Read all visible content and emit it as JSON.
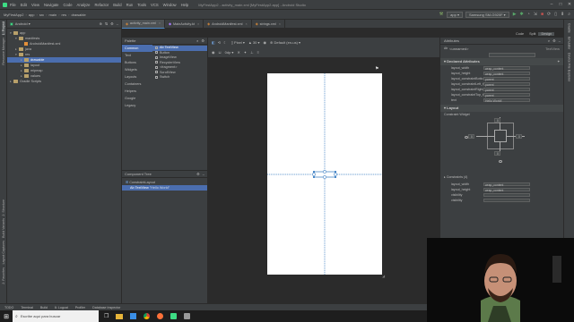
{
  "window": {
    "path_title": "MyFirstApp2 - activity_main.xml [MyFirstApp2.app] - Android Studio",
    "menu": [
      "File",
      "Edit",
      "View",
      "Navigate",
      "Code",
      "Analyze",
      "Refactor",
      "Build",
      "Run",
      "Tools",
      "VCS",
      "Window",
      "Help"
    ]
  },
  "navbar": {
    "crumbs": [
      "MyFirstApp2",
      "app",
      "src",
      "main",
      "res",
      "drawable"
    ],
    "run_config": "app",
    "device": "Samsung SM-G920F"
  },
  "left_tool_tabs": [
    "1: Project",
    "Resource Manager",
    "2: Structure",
    "Build Variants",
    "Layout Captures",
    "2: Favorites"
  ],
  "project": {
    "view_mode": "Android",
    "tree": [
      {
        "label": "app",
        "depth": 0,
        "open": true
      },
      {
        "label": "manifests",
        "depth": 1,
        "open": true
      },
      {
        "label": "AndroidManifest.xml",
        "depth": 2,
        "file": true
      },
      {
        "label": "java",
        "depth": 1,
        "open": false
      },
      {
        "label": "res",
        "depth": 1,
        "open": true
      },
      {
        "label": "drawable",
        "depth": 2,
        "open": false,
        "selected": true
      },
      {
        "label": "layout",
        "depth": 2,
        "open": false
      },
      {
        "label": "mipmap",
        "depth": 2,
        "open": false
      },
      {
        "label": "values",
        "depth": 2,
        "open": false
      },
      {
        "label": "Gradle Scripts",
        "depth": 0,
        "open": false
      }
    ]
  },
  "editor_tabs": [
    {
      "label": "activity_main.xml",
      "active": true
    },
    {
      "label": "MainActivity.kt",
      "active": false
    },
    {
      "label": "AndroidManifest.xml",
      "active": false
    },
    {
      "label": "strings.xml",
      "active": false
    }
  ],
  "view_modes": {
    "code": "Code",
    "split": "Split",
    "design": "Design"
  },
  "palette": {
    "title": "Palette",
    "categories": [
      "Common",
      "Text",
      "Buttons",
      "Widgets",
      "Layouts",
      "Containers",
      "Helpers",
      "Google",
      "Legacy"
    ],
    "items": [
      "Ab TextView",
      "Button",
      "ImageView",
      "RecyclerView",
      "<fragment>",
      "ScrollView",
      "Switch"
    ]
  },
  "component_tree": {
    "title": "Component Tree",
    "root": "ConstraintLayout",
    "child": "Ab TextView",
    "child_text": "\"Hello World\""
  },
  "design_toolbar": {
    "orientation": "Pixel",
    "api": "30",
    "theme": "Default (en-us)",
    "dp": "0dp"
  },
  "attributes": {
    "title": "Attributes",
    "widget_id": "<unnamed>",
    "widget_type": "TextView",
    "declared_title": "Declared Attributes",
    "declared": [
      {
        "k": "layout_width",
        "v": "wrap_content"
      },
      {
        "k": "layout_height",
        "v": "wrap_content"
      },
      {
        "k": "layout_constraintBotto...",
        "v": "parent"
      },
      {
        "k": "layout_constraintLeft_to...",
        "v": "parent"
      },
      {
        "k": "layout_constraintRight_t...",
        "v": "parent"
      },
      {
        "k": "layout_constraintTop_to...",
        "v": "parent"
      },
      {
        "k": "text",
        "v": "Hello World!"
      }
    ],
    "layout_title": "Layout",
    "constraint_widget": "Constraint Widget",
    "margins": [
      "0",
      "0",
      "0",
      "0"
    ],
    "constraints_title": "Constraints (4)",
    "layout_rows": [
      {
        "k": "layout_width",
        "v": "wrap_content"
      },
      {
        "k": "layout_height",
        "v": "wrap_content"
      },
      {
        "k": "visibility",
        "v": ""
      },
      {
        "k": "visibility",
        "v": ""
      }
    ]
  },
  "right_tool_tabs": [
    "Gradle",
    "Emulator",
    "Device File Explorer"
  ],
  "bottom_tabs": [
    "TODO",
    "Terminal",
    "Build",
    "6: Logcat",
    "Profiler",
    "Database Inspector"
  ],
  "taskbar": {
    "search_placeholder": "Escribe aquí para buscar"
  },
  "colors": {
    "selection": "#4b6eaf",
    "blueprint": "#4a88c7",
    "folder": "#b8a06a"
  }
}
